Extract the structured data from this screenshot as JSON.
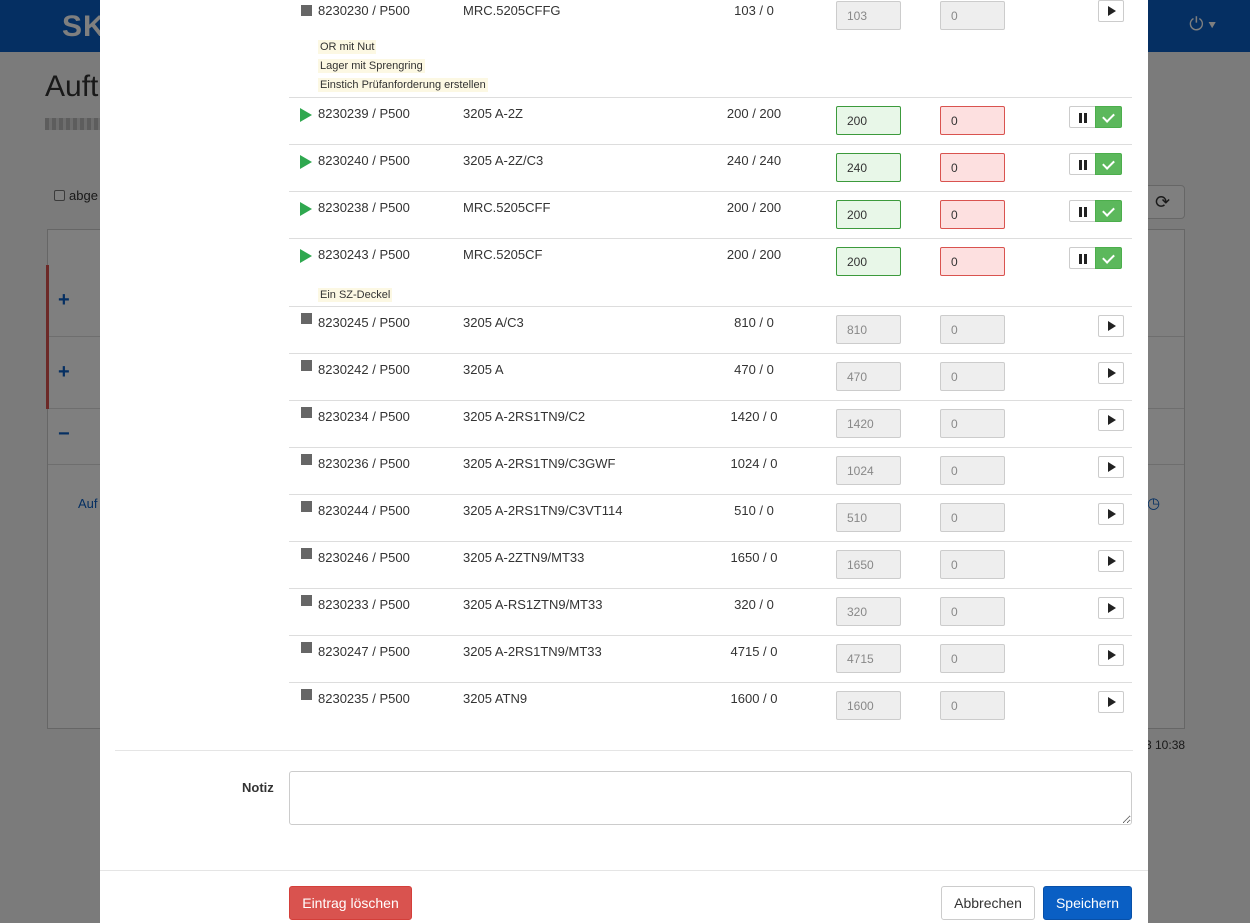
{
  "background": {
    "logo": "SK",
    "heading": "Auft",
    "checkbox_label": "abge",
    "link_text": "Auf",
    "time_text": "3 10:38",
    "power_icon": "power-icon",
    "refresh_icon": "refresh-icon",
    "clock_icon": "clock-icon"
  },
  "rows": [
    {
      "status": "stopped",
      "order": "8230230 / P500",
      "article": "MRC.5205CFFG",
      "qty": "103 / 0",
      "in1": "103",
      "in2": "0",
      "action": "play",
      "notes": [
        "OR mit Nut",
        "Lager mit Sprengring",
        "Einstich Prüfanforderung erstellen"
      ]
    },
    {
      "status": "running",
      "order": "8230239 / P500",
      "article": "3205 A-2Z",
      "qty": "200 / 200",
      "in1": "200",
      "in2": "0",
      "action": "pause-check",
      "notes": []
    },
    {
      "status": "running",
      "order": "8230240 / P500",
      "article": "3205 A-2Z/C3",
      "qty": "240 / 240",
      "in1": "240",
      "in2": "0",
      "action": "pause-check",
      "notes": []
    },
    {
      "status": "running",
      "order": "8230238 / P500",
      "article": "MRC.5205CFF",
      "qty": "200 / 200",
      "in1": "200",
      "in2": "0",
      "action": "pause-check",
      "notes": []
    },
    {
      "status": "running",
      "order": "8230243 / P500",
      "article": "MRC.5205CF",
      "qty": "200 / 200",
      "in1": "200",
      "in2": "0",
      "action": "pause-check",
      "notes": [
        "Ein SZ-Deckel"
      ]
    },
    {
      "status": "stopped",
      "order": "8230245 / P500",
      "article": "3205 A/C3",
      "qty": "810 / 0",
      "in1": "810",
      "in2": "0",
      "action": "play",
      "notes": []
    },
    {
      "status": "stopped",
      "order": "8230242 / P500",
      "article": "3205 A",
      "qty": "470 / 0",
      "in1": "470",
      "in2": "0",
      "action": "play",
      "notes": []
    },
    {
      "status": "stopped",
      "order": "8230234 / P500",
      "article": "3205 A-2RS1TN9/C2",
      "qty": "1420 / 0",
      "in1": "1420",
      "in2": "0",
      "action": "play",
      "notes": []
    },
    {
      "status": "stopped",
      "order": "8230236 / P500",
      "article": "3205 A-2RS1TN9/C3GWF",
      "qty": "1024 / 0",
      "in1": "1024",
      "in2": "0",
      "action": "play",
      "notes": []
    },
    {
      "status": "stopped",
      "order": "8230244 / P500",
      "article": "3205 A-2RS1TN9/C3VT114",
      "qty": "510 / 0",
      "in1": "510",
      "in2": "0",
      "action": "play",
      "notes": []
    },
    {
      "status": "stopped",
      "order": "8230246 / P500",
      "article": "3205 A-2ZTN9/MT33",
      "qty": "1650 / 0",
      "in1": "1650",
      "in2": "0",
      "action": "play",
      "notes": []
    },
    {
      "status": "stopped",
      "order": "8230233 / P500",
      "article": "3205 A-RS1ZTN9/MT33",
      "qty": "320 / 0",
      "in1": "320",
      "in2": "0",
      "action": "play",
      "notes": []
    },
    {
      "status": "stopped",
      "order": "8230247 / P500",
      "article": "3205 A-2RS1TN9/MT33",
      "qty": "4715 / 0",
      "in1": "4715",
      "in2": "0",
      "action": "play",
      "notes": []
    },
    {
      "status": "stopped",
      "order": "8230235 / P500",
      "article": "3205 ATN9",
      "qty": "1600 / 0",
      "in1": "1600",
      "in2": "0",
      "action": "play",
      "notes": []
    }
  ],
  "notiz": {
    "label": "Notiz",
    "value": ""
  },
  "footer": {
    "delete_label": "Eintrag löschen",
    "cancel_label": "Abbrechen",
    "save_label": "Speichern"
  },
  "colors": {
    "primary": "#0a5fc4",
    "danger": "#d9534f",
    "success": "#5cb85c",
    "running": "#2fa84f"
  }
}
